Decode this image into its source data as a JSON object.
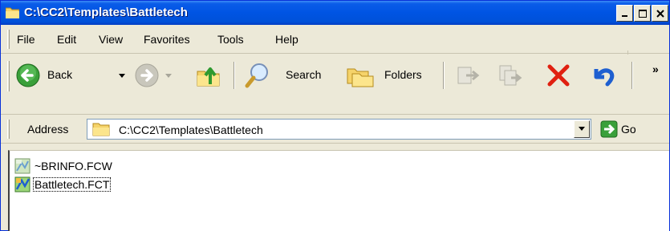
{
  "window": {
    "title": "C:\\CC2\\Templates\\Battletech",
    "min_glyph": "_",
    "max_glyph": "□",
    "close_glyph": "×"
  },
  "menu": {
    "items": [
      {
        "label": "File"
      },
      {
        "label": "Edit"
      },
      {
        "label": "View"
      },
      {
        "label": "Favorites"
      },
      {
        "label": "Tools"
      },
      {
        "label": "Help"
      }
    ]
  },
  "toolbar": {
    "back_label": "Back",
    "search_label": "Search",
    "folders_label": "Folders",
    "overflow": "»"
  },
  "address": {
    "label": "Address",
    "value": "C:\\CC2\\Templates\\Battletech",
    "go_label": "Go"
  },
  "files": [
    {
      "name": "~BRINFO.FCW",
      "icon": "fcw-file-icon",
      "focused": false
    },
    {
      "name": "Battletech.FCT",
      "icon": "fct-file-icon",
      "focused": true
    }
  ],
  "colors": {
    "titlebar": "#0054e3",
    "chrome": "#ece9d8",
    "back_green": "#3aa03a",
    "delete_red": "#e02010"
  }
}
